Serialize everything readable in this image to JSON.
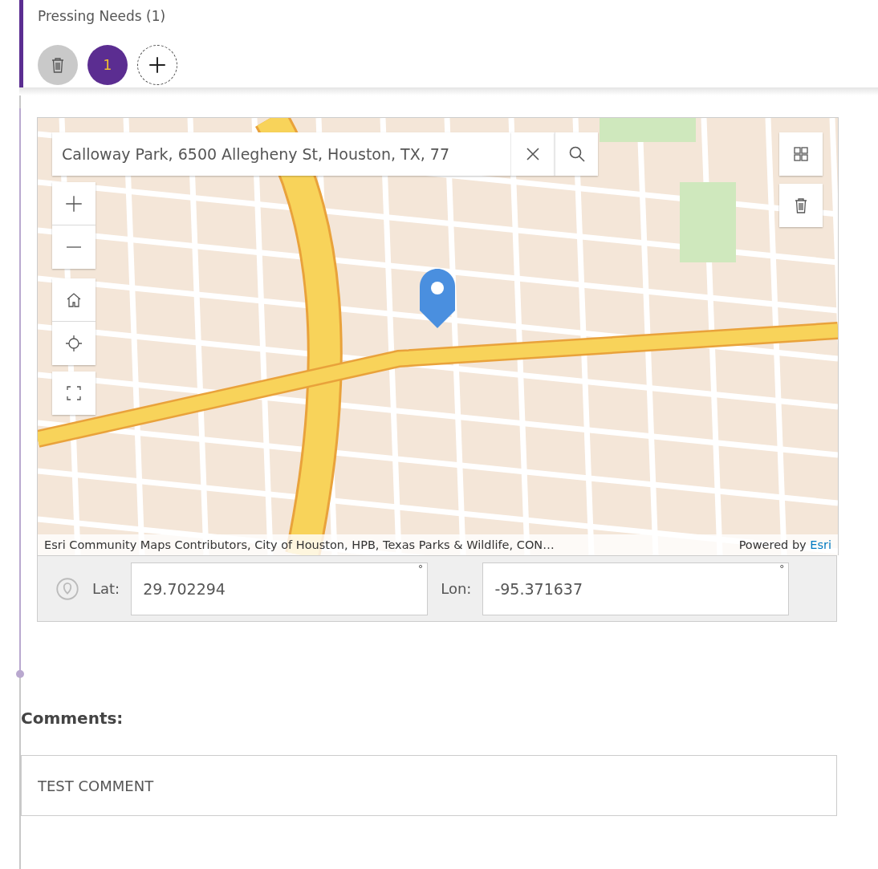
{
  "section": {
    "title": "Pressing Needs (1)",
    "records": [
      {
        "label": "1",
        "selected": true
      }
    ]
  },
  "map": {
    "search": {
      "value": "Calloway Park, 6500 Allegheny St, Houston, TX, 77"
    },
    "attribution": "Esri Community Maps Contributors, City of Houston, HPB, Texas Parks & Wildlife, CON…",
    "powered_by": "Powered by",
    "powered_link": "Esri"
  },
  "coordinates": {
    "lat_label": "Lat:",
    "lat": "29.702294",
    "lat_unit": "°",
    "lon_label": "Lon:",
    "lon": "-95.371637",
    "lon_unit": "°"
  },
  "comments": {
    "label": "Comments:",
    "value": "TEST COMMENT"
  }
}
